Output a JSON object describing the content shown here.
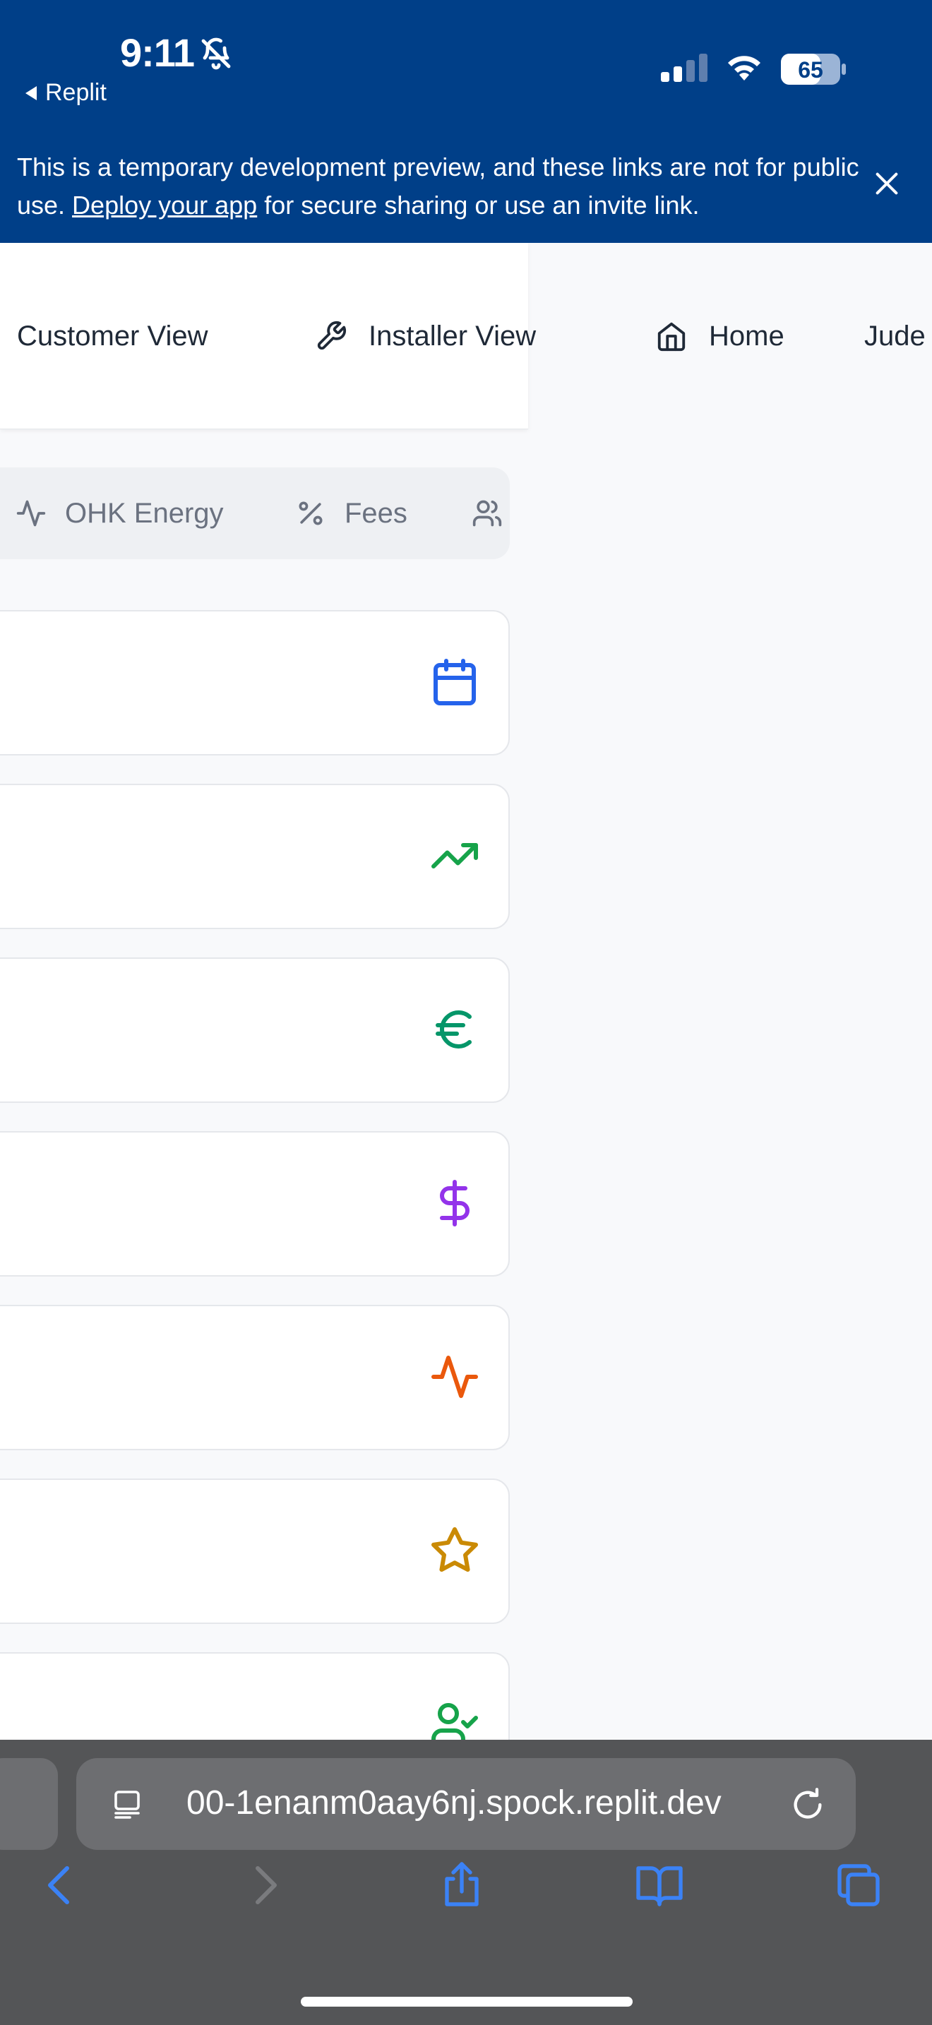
{
  "status_bar": {
    "time": "9:11",
    "back_app": "Replit",
    "battery": "65"
  },
  "banner": {
    "text_before": "This is a temporary development preview, and these links are not for public use. ",
    "link_text": "Deploy your app",
    "text_after": " for secure sharing or use an invite link."
  },
  "nav": {
    "customer_view": "Customer View",
    "installer_view": "Installer View",
    "home": "Home",
    "truncated": "Jude"
  },
  "tabs": {
    "ohk_energy": "OHK Energy",
    "fees": "Fees"
  },
  "cards": [
    {
      "icon": "calendar-icon",
      "color": "#2563eb"
    },
    {
      "icon": "trending-up-icon",
      "color": "#16a34a"
    },
    {
      "icon": "euro-icon",
      "color": "#059669"
    },
    {
      "icon": "dollar-icon",
      "color": "#9333ea"
    },
    {
      "icon": "activity-icon",
      "color": "#ea580c"
    },
    {
      "icon": "star-icon",
      "color": "#ca8a04"
    },
    {
      "icon": "user-check-icon",
      "color": "#16a34a"
    }
  ],
  "browser": {
    "url": "00-1enanm0aay6nj.spock.replit.dev"
  },
  "colors": {
    "banner_bg": "#003f88",
    "browser_bg": "#545557",
    "toolbar_blue": "#3b82f6"
  }
}
